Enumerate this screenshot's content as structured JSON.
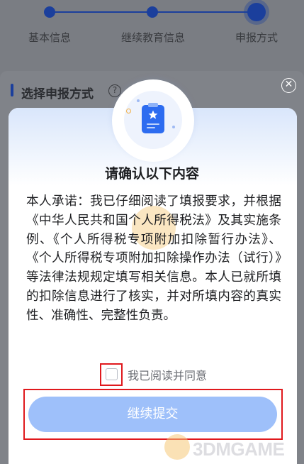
{
  "stepper": {
    "steps": [
      {
        "label": "基本信息"
      },
      {
        "label": "继续教育信息"
      },
      {
        "label": "申报方式"
      }
    ],
    "current_step": 3
  },
  "section": {
    "title": "选择申报方式",
    "help_icon": "question-circle-icon",
    "help_glyph": "?"
  },
  "modal": {
    "close_glyph": "✕",
    "icon": "document-star-icon",
    "title": "请确认以下内容",
    "pledge": "本人承诺：我已仔细阅读了填报要求，并根据《中华人民共和国个人所得税法》及其实施条例、《个人所得税专项附加扣除暂行办法》、《个人所得税专项附加扣除操作办法（试行）》等法律法规规定填写相关信息。本人已就所填的扣除信息进行了核实，并对所填内容的真实性、准确性、完整性负责。",
    "agree_label": "我已阅读并同意",
    "agree_checked": false,
    "submit_label": "继续提交"
  },
  "watermark": {
    "text": "3DMGAME"
  },
  "colors": {
    "accent": "#1b3f9c",
    "button": "#9ec0fa",
    "highlight_frame": "#e0191d"
  }
}
